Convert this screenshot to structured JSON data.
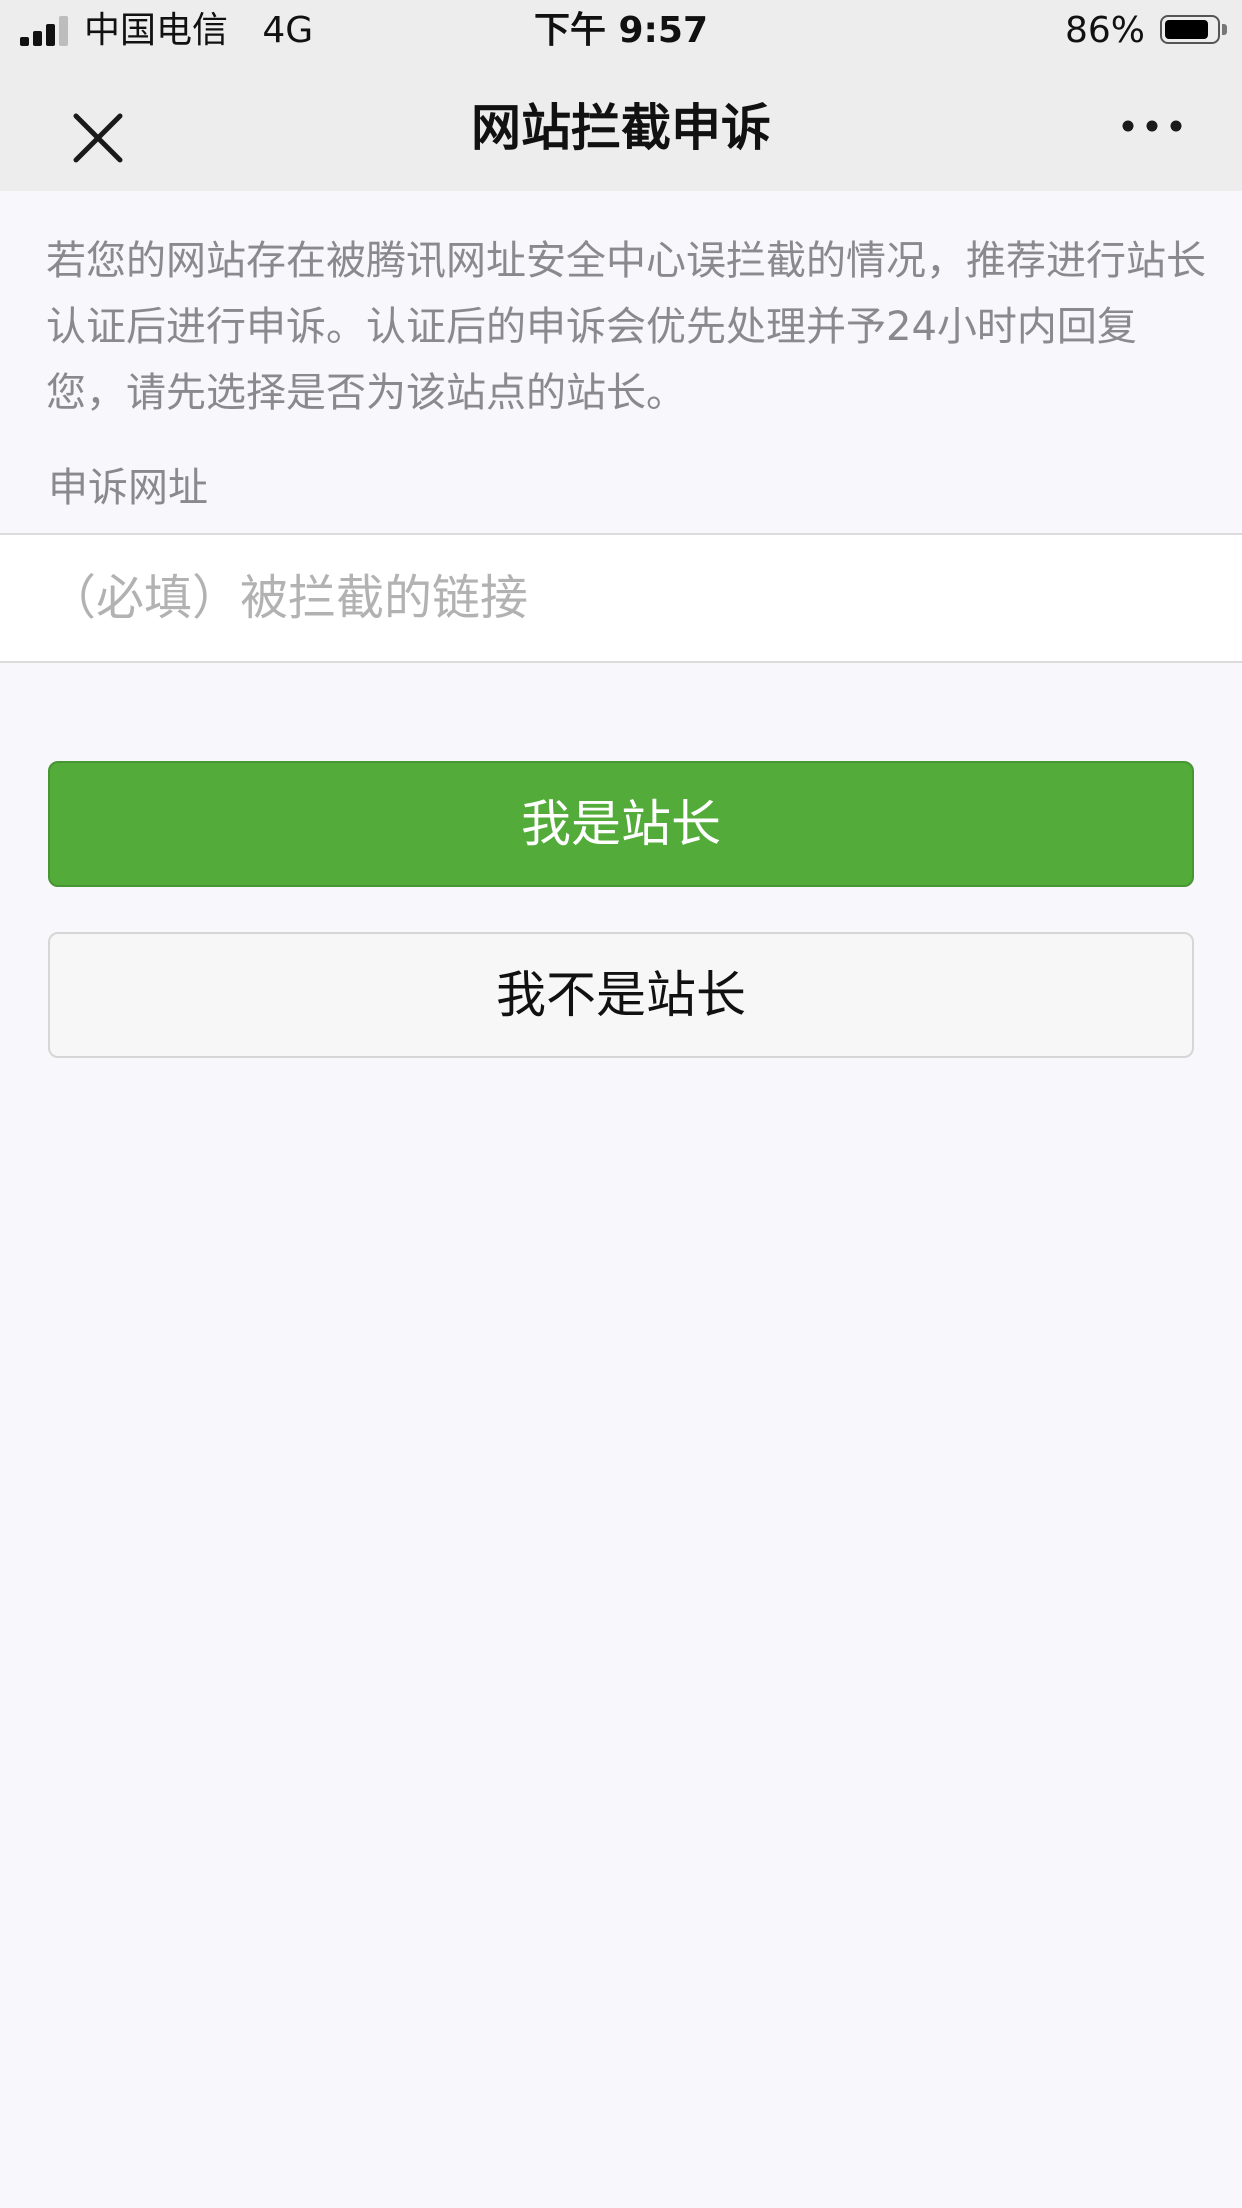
{
  "status_bar": {
    "carrier": "中国电信",
    "network": "4G",
    "time": "下午 9:57",
    "battery_percent": "86%",
    "battery_level": 0.86,
    "signal_bars": 3
  },
  "nav": {
    "title": "网站拦截申诉",
    "close_icon": "close-icon",
    "more_icon": "more-icon"
  },
  "intro_text": "若您的网站存在被腾讯网址安全中心误拦截的情况，推荐进行站长认证后进行申诉。认证后的申诉会优先处理并予24小时内回复您，请先选择是否为该站点的站长。",
  "form": {
    "url_label": "申诉网址",
    "url_placeholder": "（必填）被拦截的链接",
    "url_value": ""
  },
  "buttons": {
    "owner": "我是站长",
    "not_owner": "我不是站长"
  },
  "colors": {
    "primary": "#53ab3a",
    "nav_background": "#ededed",
    "page_background": "#f8f7fc"
  }
}
